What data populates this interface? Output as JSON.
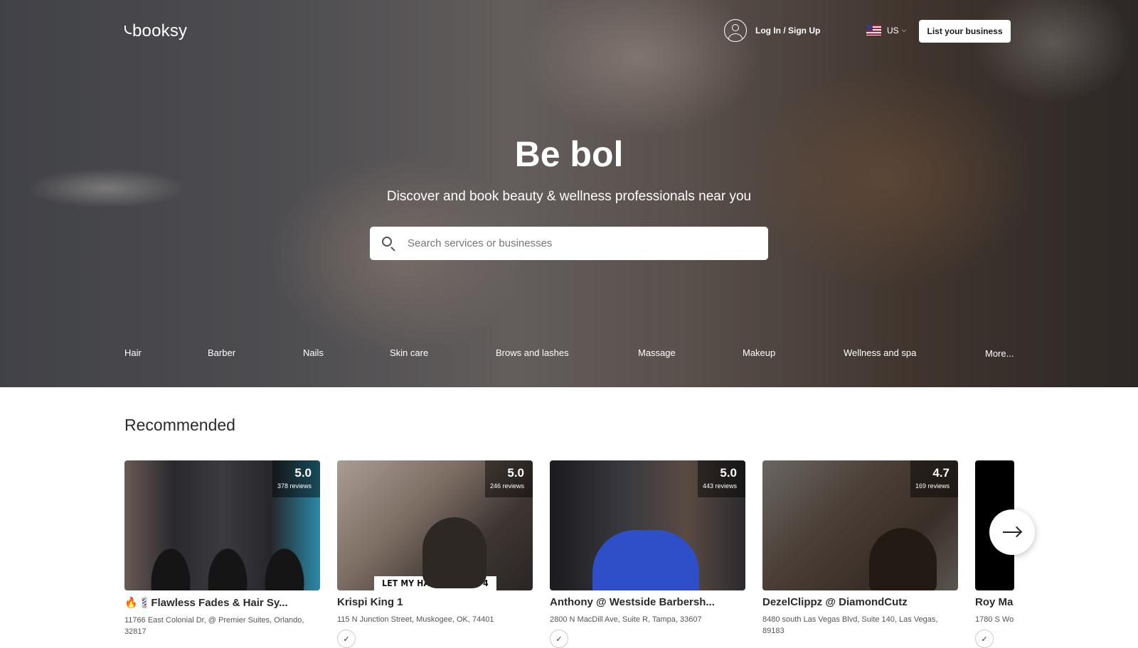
{
  "header": {
    "logo": "booksy",
    "login_label": "Log In / Sign Up",
    "locale_label": "US",
    "locale_chevron": "⌵",
    "list_business_label": "List your business"
  },
  "hero": {
    "title": "Be bol",
    "subtitle": "Discover and book beauty & wellness professionals near you",
    "search_placeholder": "Search services or businesses"
  },
  "categories": [
    "Hair",
    "Barber",
    "Nails",
    "Skin care",
    "Brows and lashes",
    "Massage",
    "Makeup",
    "Wellness and spa",
    "More..."
  ],
  "recommended": {
    "title": "Recommended",
    "cards": [
      {
        "name": "🔥💈Flawless Fades & Hair Sy...",
        "address": "11766 East Colonial Dr, @ Premier Suites, Orlando, 32817",
        "rating": "5.0",
        "reviews": "378 reviews"
      },
      {
        "name": "Krispi King 1",
        "address": "115 N Junction Street, Muskogee, OK, 74401",
        "rating": "5.0",
        "reviews": "246 reviews",
        "image_caption": "LET MY HANDS SPEAK 4 ME"
      },
      {
        "name": "Anthony @ Westside Barbersh...",
        "address": "2800 N MacDill Ave, Suite R, Tampa, 33607",
        "rating": "5.0",
        "reviews": "443 reviews"
      },
      {
        "name": "DezelClippz @ DiamondCutz",
        "address": "8480 south Las Vegas Blvd, Suite 140, Las Vegas, 89183",
        "rating": "4.7",
        "reviews": "169 reviews"
      },
      {
        "name": "Roy Ma",
        "address": "1780 S Wo"
      }
    ]
  },
  "icons": {
    "user": "user-icon",
    "flag": "us-flag-icon",
    "search": "search-icon",
    "next": "arrow-right-icon"
  },
  "colors": {
    "button_bg": "#ffffff",
    "rating_overlay": "rgba(0,0,0,0.45)",
    "text_dark": "#2b2b2b"
  }
}
